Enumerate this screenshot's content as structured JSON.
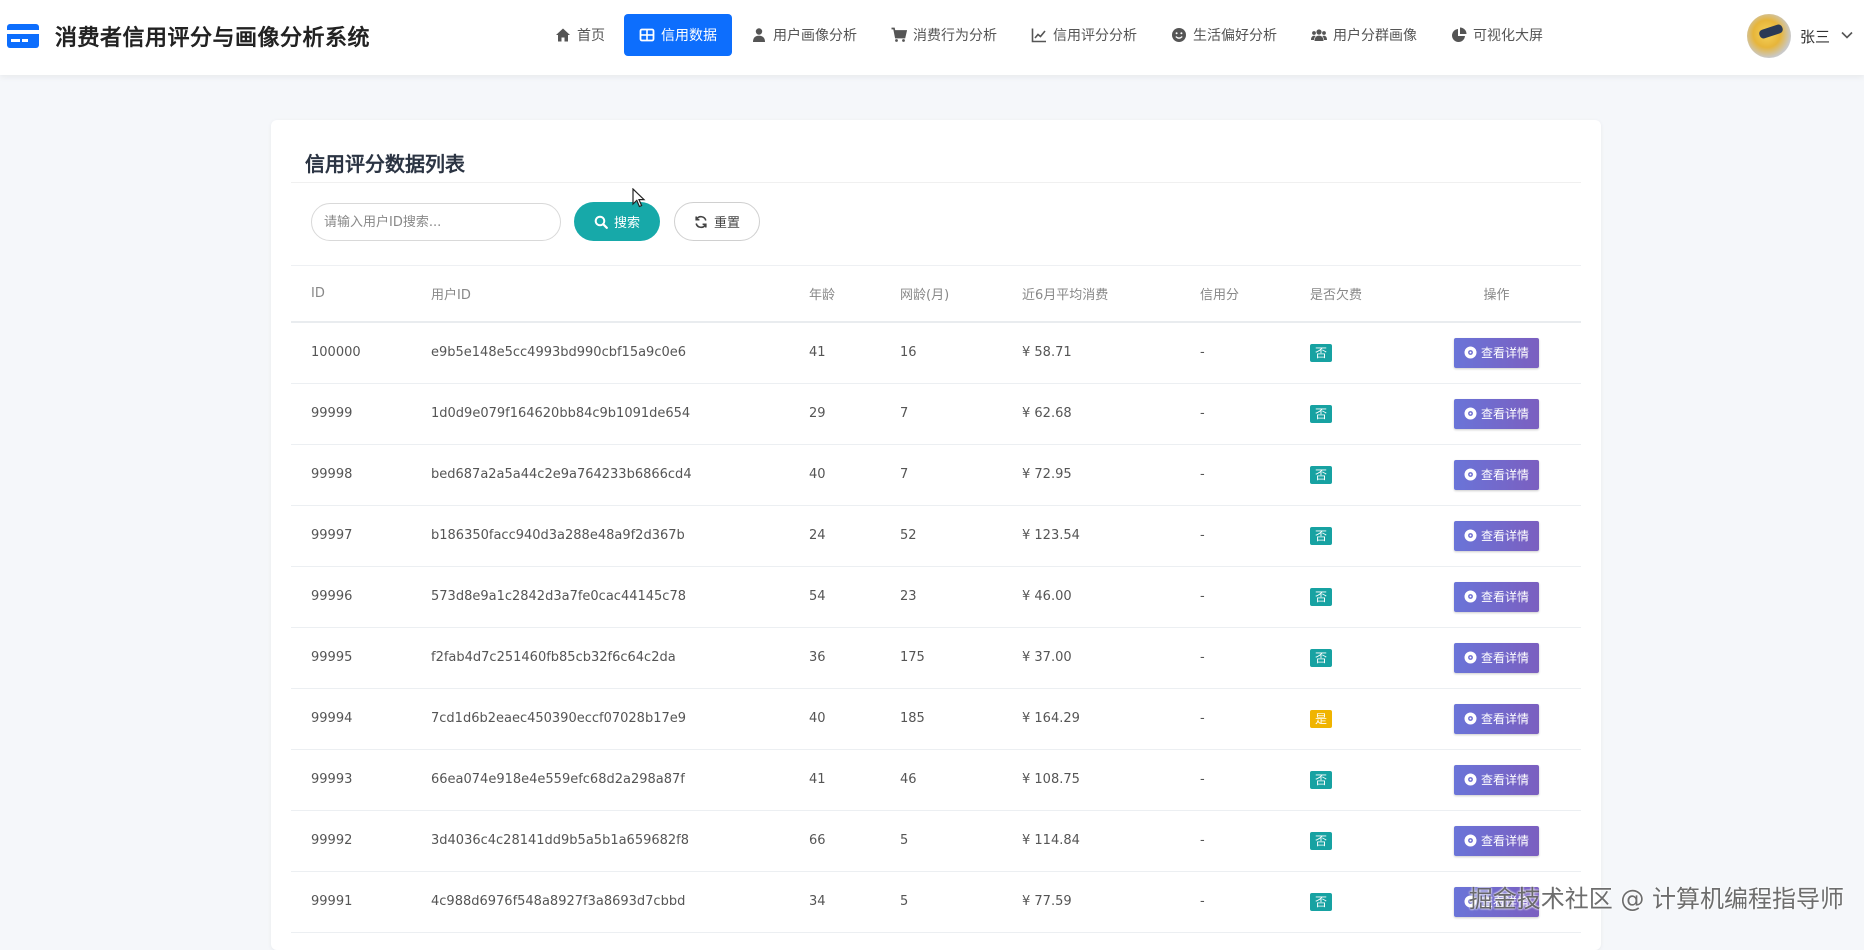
{
  "app": {
    "title": "消费者信用评分与画像分析系统",
    "accent": "#0d6efd",
    "brand_icon": "credit-card-icon"
  },
  "nav": {
    "items": [
      {
        "label": "首页",
        "icon": "home-icon",
        "active": false
      },
      {
        "label": "信用数据",
        "icon": "table-icon",
        "active": true
      },
      {
        "label": "用户画像分析",
        "icon": "user-icon",
        "active": false
      },
      {
        "label": "消费行为分析",
        "icon": "cart-icon",
        "active": false
      },
      {
        "label": "信用评分分析",
        "icon": "line-chart-icon",
        "active": false
      },
      {
        "label": "生活偏好分析",
        "icon": "smile-icon",
        "active": false
      },
      {
        "label": "用户分群画像",
        "icon": "users-icon",
        "active": false
      },
      {
        "label": "可视化大屏",
        "icon": "pie-chart-icon",
        "active": false
      }
    ]
  },
  "user": {
    "name": "张三",
    "dropdown_icon": "chevron-down-icon"
  },
  "card": {
    "title": "信用评分数据列表"
  },
  "search": {
    "placeholder": "请输入用户ID搜索...",
    "value": "",
    "search_label": "搜索",
    "reset_label": "重置"
  },
  "table": {
    "columns": [
      "ID",
      "用户ID",
      "年龄",
      "网龄(月)",
      "近6月平均消费",
      "信用分",
      "是否欠费",
      "操作"
    ],
    "detail_label": "查看详情",
    "rows": [
      {
        "id": "100000",
        "uid": "e9b5e148e5cc4993bd990cbf15a9c0e6",
        "age": "41",
        "net": "16",
        "spend": "¥ 58.71",
        "score": "-",
        "debt": "否"
      },
      {
        "id": "99999",
        "uid": "1d0d9e079f164620bb84c9b1091de654",
        "age": "29",
        "net": "7",
        "spend": "¥ 62.68",
        "score": "-",
        "debt": "否"
      },
      {
        "id": "99998",
        "uid": "bed687a2a5a44c2e9a764233b6866cd4",
        "age": "40",
        "net": "7",
        "spend": "¥ 72.95",
        "score": "-",
        "debt": "否"
      },
      {
        "id": "99997",
        "uid": "b186350facc940d3a288e48a9f2d367b",
        "age": "24",
        "net": "52",
        "spend": "¥ 123.54",
        "score": "-",
        "debt": "否"
      },
      {
        "id": "99996",
        "uid": "573d8e9a1c2842d3a7fe0cac44145c78",
        "age": "54",
        "net": "23",
        "spend": "¥ 46.00",
        "score": "-",
        "debt": "否"
      },
      {
        "id": "99995",
        "uid": "f2fab4d7c251460fb85cb32f6c64c2da",
        "age": "36",
        "net": "175",
        "spend": "¥ 37.00",
        "score": "-",
        "debt": "否"
      },
      {
        "id": "99994",
        "uid": "7cd1d6b2eaec450390eccf07028b17e9",
        "age": "40",
        "net": "185",
        "spend": "¥ 164.29",
        "score": "-",
        "debt": "是"
      },
      {
        "id": "99993",
        "uid": "66ea074e918e4e559efc68d2a298a87f",
        "age": "41",
        "net": "46",
        "spend": "¥ 108.75",
        "score": "-",
        "debt": "否"
      },
      {
        "id": "99992",
        "uid": "3d4036c4c28141dd9b5a5b1a659682f8",
        "age": "66",
        "net": "5",
        "spend": "¥ 114.84",
        "score": "-",
        "debt": "否"
      },
      {
        "id": "99991",
        "uid": "4c988d6976f548a8927f3a8693d7cbbd",
        "age": "34",
        "net": "5",
        "spend": "¥ 77.59",
        "score": "-",
        "debt": "否"
      }
    ]
  },
  "colors": {
    "badge_no": "#17a2a2",
    "badge_yes": "#f0b400",
    "search_button": "#17a9a9"
  },
  "watermark": "掘金技术社区 @ 计算机编程指导师"
}
